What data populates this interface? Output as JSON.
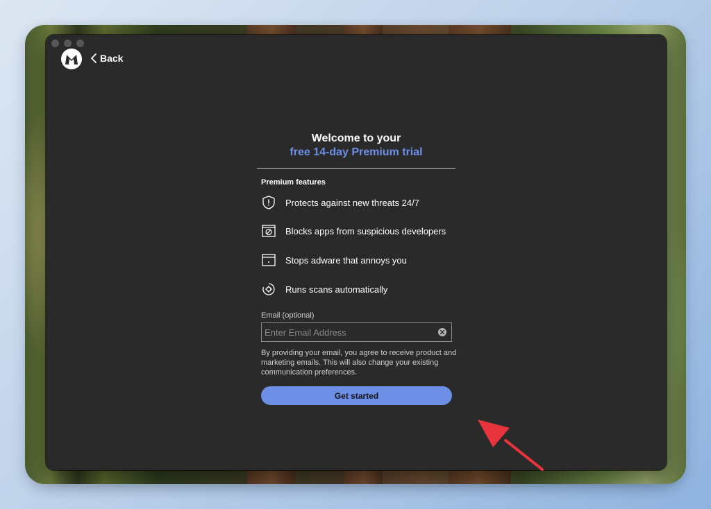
{
  "header": {
    "back_label": "Back"
  },
  "welcome": {
    "title_line1": "Welcome to your",
    "title_line2": "free 14-day Premium trial"
  },
  "features": {
    "heading": "Premium features",
    "items": [
      {
        "label": "Protects against new threats 24/7",
        "icon": "shield-icon"
      },
      {
        "label": "Blocks apps from suspicious developers",
        "icon": "blocked-app-icon"
      },
      {
        "label": "Stops adware that annoys you",
        "icon": "browser-window-icon"
      },
      {
        "label": "Runs scans automatically",
        "icon": "scan-target-icon"
      }
    ]
  },
  "email": {
    "label": "Email (optional)",
    "placeholder": "Enter Email Address",
    "value": "",
    "disclaimer": "By providing your email, you agree to receive product and marketing emails. This will also change your existing communication preferences."
  },
  "cta": {
    "label": "Get started"
  },
  "colors": {
    "accent": "#6d8fe6",
    "window_bg": "#2a2a2a",
    "annotation_arrow": "#e8343c"
  }
}
